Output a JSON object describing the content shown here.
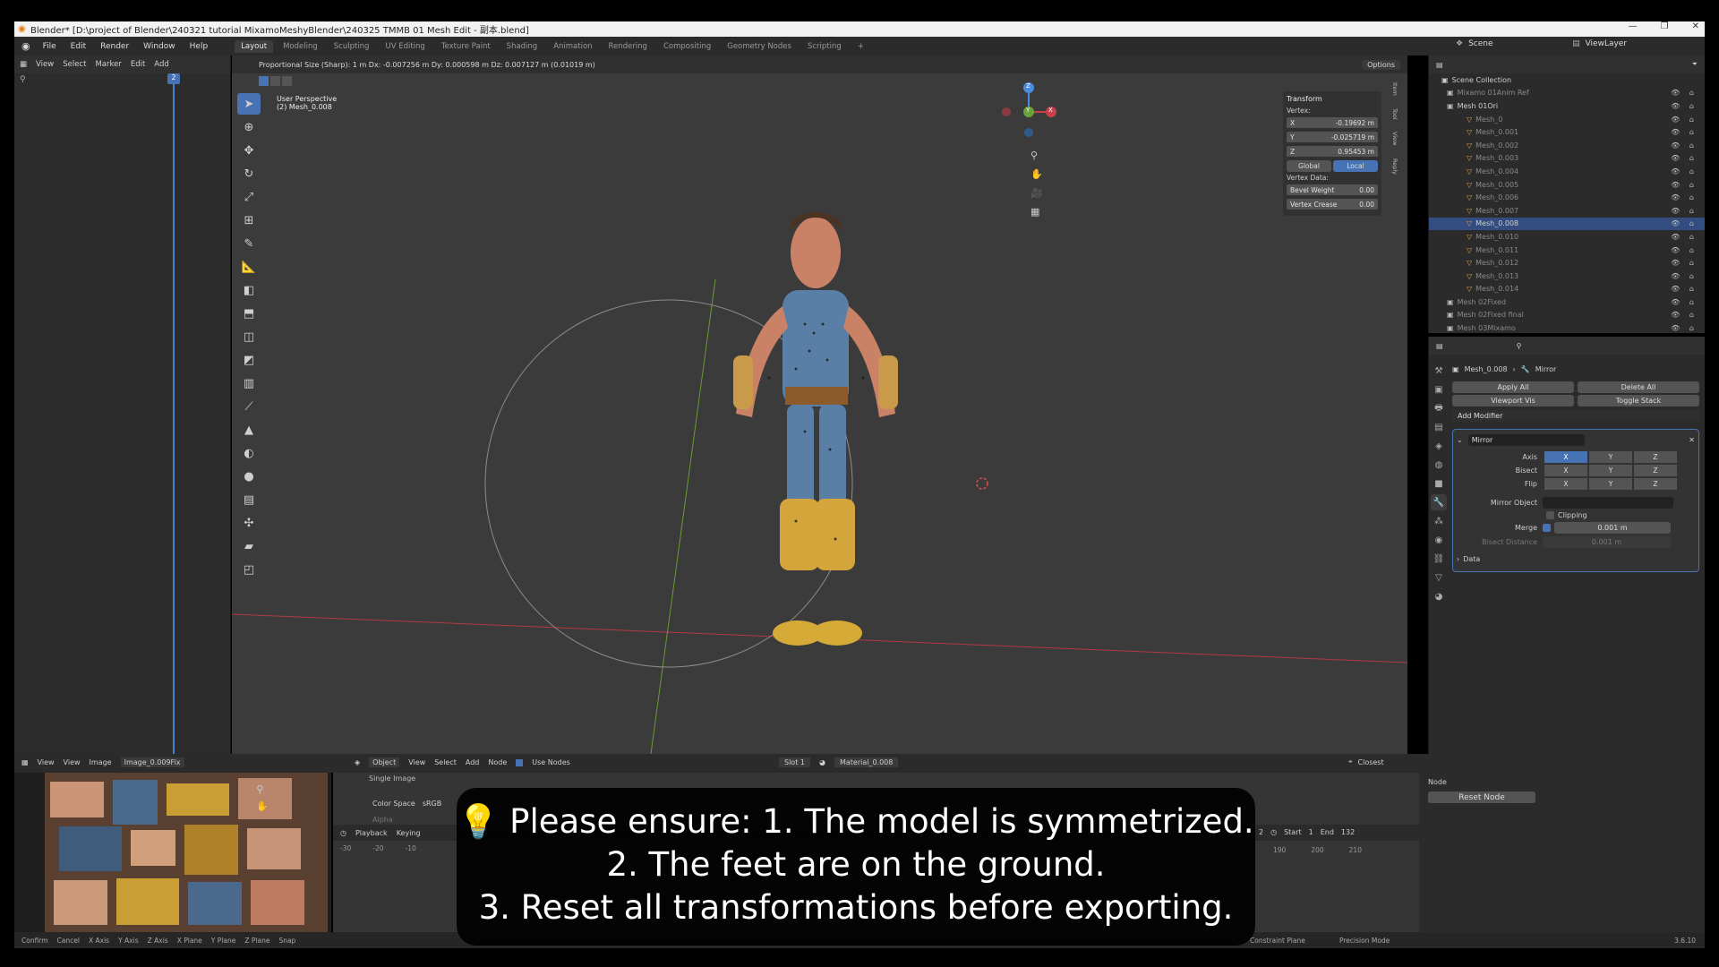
{
  "window": {
    "title": "Blender* [D:\\project of Blender\\240321 tutorial MixamoMeshyBlender\\240325 TMMB 01 Mesh Edit - 副本.blend]"
  },
  "menu": {
    "items": [
      "File",
      "Edit",
      "Render",
      "Window",
      "Help"
    ],
    "workspaces": [
      "Layout",
      "Modeling",
      "Sculpting",
      "UV Editing",
      "Texture Paint",
      "Shading",
      "Animation",
      "Rendering",
      "Compositing",
      "Geometry Nodes",
      "Scripting",
      "+"
    ],
    "active_workspace": "Layout",
    "scene": "Scene",
    "view_layer": "ViewLayer"
  },
  "left_panel": {
    "header": [
      "View",
      "Select",
      "Marker",
      "Edit",
      "Add"
    ],
    "frame": "2"
  },
  "viewport": {
    "header_text": "Proportional Size (Sharp): 1 m   Dx: -0.007256 m   Dy: 0.000598 m   Dz: 0.007127 m (0.01019 m)",
    "options_label": "Options",
    "view_name": "User Perspective",
    "object_name": "(2) Mesh_0.008",
    "axis_labels": [
      "X",
      "Y",
      "Z"
    ]
  },
  "transform_panel": {
    "title": "Transform",
    "vertex_label": "Vertex:",
    "x": {
      "label": "X",
      "value": "-0.19692 m"
    },
    "y": {
      "label": "Y",
      "value": "-0.025719 m"
    },
    "z": {
      "label": "Z",
      "value": "0.95453 m"
    },
    "global": "Global",
    "local": "Local",
    "vertex_data_label": "Vertex Data:",
    "bevel_weight": {
      "label": "Bevel Weight",
      "value": "0.00"
    },
    "vertex_crease": {
      "label": "Vertex Crease",
      "value": "0.00"
    },
    "side_tabs": [
      "Item",
      "Tool",
      "View",
      "Reply"
    ]
  },
  "outliner": {
    "collection": "Scene Collection",
    "items": [
      {
        "name": "Mixamo 01Anim Ref",
        "level": 0,
        "dim": true
      },
      {
        "name": "Mesh 01Ori",
        "level": 0,
        "dim": false
      },
      {
        "name": "Mesh_0",
        "level": 1,
        "dim": true
      },
      {
        "name": "Mesh_0.001",
        "level": 1,
        "dim": true
      },
      {
        "name": "Mesh_0.002",
        "level": 1,
        "dim": true
      },
      {
        "name": "Mesh_0.003",
        "level": 1,
        "dim": true
      },
      {
        "name": "Mesh_0.004",
        "level": 1,
        "dim": true
      },
      {
        "name": "Mesh_0.005",
        "level": 1,
        "dim": true
      },
      {
        "name": "Mesh_0.006",
        "level": 1,
        "dim": true
      },
      {
        "name": "Mesh_0.007",
        "level": 1,
        "dim": true
      },
      {
        "name": "Mesh_0.008",
        "level": 1,
        "dim": false,
        "selected": true
      },
      {
        "name": "Mesh_0.010",
        "level": 1,
        "dim": true
      },
      {
        "name": "Mesh_0.011",
        "level": 1,
        "dim": true
      },
      {
        "name": "Mesh_0.012",
        "level": 1,
        "dim": true
      },
      {
        "name": "Mesh_0.013",
        "level": 1,
        "dim": true
      },
      {
        "name": "Mesh_0.014",
        "level": 1,
        "dim": true
      },
      {
        "name": "Mesh 02Fixed",
        "level": 0,
        "dim": true
      },
      {
        "name": "Mesh 02Fixed final",
        "level": 0,
        "dim": true
      },
      {
        "name": "Mesh 03Mixamo",
        "level": 0,
        "dim": true
      }
    ]
  },
  "properties": {
    "breadcrumb_object": "Mesh_0.008",
    "breadcrumb_modifier": "Mirror",
    "apply_all": "Apply All",
    "delete_all": "Delete All",
    "viewport_vis": "Viewport Vis",
    "toggle_stack": "Toggle Stack",
    "add_modifier": "Add Modifier",
    "modifier_name": "Mirror",
    "axis_label": "Axis",
    "bisect_label": "Bisect",
    "flip_label": "Flip",
    "axes": [
      "X",
      "Y",
      "Z"
    ],
    "mirror_object_label": "Mirror Object",
    "clipping_label": "Clipping",
    "merge_label": "Merge",
    "merge_value": "0.001 m",
    "bisect_distance_label": "Bisect Distance",
    "bisect_distance_value": "0.001 m",
    "data_label": "Data"
  },
  "bottom": {
    "image_editor_menus": [
      "View",
      "View",
      "Image"
    ],
    "image_name": "Image_0.009Fix",
    "node_mode": "Object",
    "node_menus": [
      "View",
      "Select",
      "Add",
      "Node"
    ],
    "use_nodes": "Use Nodes",
    "slot": "Slot 1",
    "material": "Material_0.008",
    "single_image": "Single Image",
    "color_space_label": "Color Space",
    "color_space_value": "sRGB",
    "alpha_label": "Alpha",
    "playback": "Playback",
    "keying": "Keying",
    "timeline_ticks": [
      "-30",
      "-20",
      "-10"
    ],
    "timeline_ticks_right": [
      "2",
      "190",
      "200",
      "210"
    ],
    "node_panel_title": "Node",
    "reset_node": "Reset Node",
    "start_label": "Start",
    "start_value": "1",
    "end_label": "End",
    "end_value": "132",
    "snap_mode": "Closest"
  },
  "statusbar": {
    "items": [
      "Confirm",
      "Cancel",
      "X Axis",
      "Y Axis",
      "Z Axis",
      "X Plane",
      "Y Plane",
      "Z Plane",
      "Snap"
    ],
    "right_items": [
      "Constraint Plane",
      "Precision Mode"
    ],
    "version": "3.6.10"
  },
  "subtitle": {
    "line1": "💡 Please ensure: 1. The model is symmetrized.",
    "line2": "2. The feet are on the ground.",
    "line3": "3. Reset all transformations before exporting."
  },
  "colors": {
    "accent": "#4772b3",
    "viewport_bg": "#3b3b3b",
    "panel_bg": "#2b2b2b",
    "x_axis": "#c8404b",
    "y_axis": "#6ba539",
    "z_axis": "#4a8be0"
  }
}
